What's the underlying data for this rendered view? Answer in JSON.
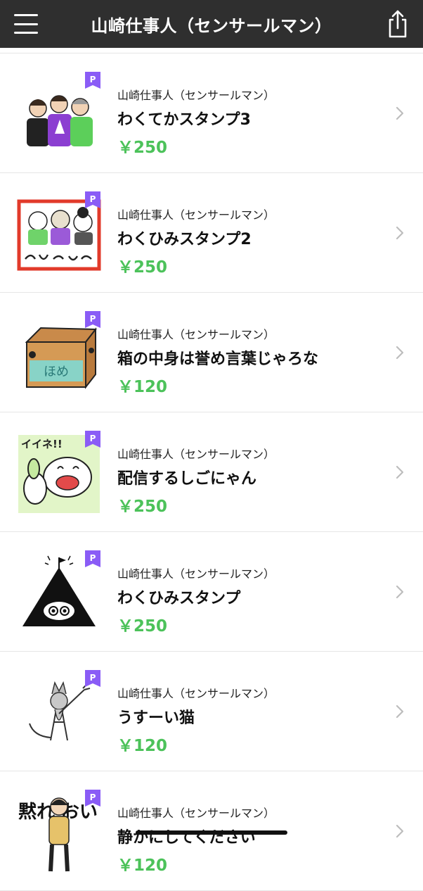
{
  "header": {
    "title": "山崎仕事人（センサールマン）",
    "menu_icon": "hamburger-menu-icon",
    "share_icon": "share-icon"
  },
  "colors": {
    "header_bg": "#2f2f2f",
    "price": "#4cc25a",
    "premium_badge": "#8a5cf6"
  },
  "products": [
    {
      "author": "山崎仕事人（センサールマン）",
      "name": "わくてかスタンプ3",
      "price": "￥250",
      "badge": "P",
      "thumb_icon": "three-men-sticker-icon"
    },
    {
      "author": "山崎仕事人（センサールマン）",
      "name": "わくひみスタンプ2",
      "price": "￥250",
      "badge": "P",
      "thumb_icon": "framed-three-faces-sticker-icon"
    },
    {
      "author": "山崎仕事人（センサールマン）",
      "name": "箱の中身は誉め言葉じゃろな",
      "price": "￥120",
      "badge": "P",
      "thumb_icon": "cardboard-box-sticker-icon",
      "thumb_text": "ほめ"
    },
    {
      "author": "山崎仕事人（センサールマン）",
      "name": "配信するしごにゃん",
      "price": "￥250",
      "badge": "P",
      "thumb_icon": "thumbs-up-cat-sticker-icon",
      "thumb_text": "イイネ!!"
    },
    {
      "author": "山崎仕事人（センサールマン）",
      "name": "わくひみスタンプ",
      "price": "￥250",
      "badge": "P",
      "thumb_icon": "triangle-eyes-sticker-icon"
    },
    {
      "author": "山崎仕事人（センサールマン）",
      "name": "うすーい猫",
      "price": "￥120",
      "badge": "P",
      "thumb_icon": "thin-cat-sticker-icon"
    },
    {
      "author": "山崎仕事人（センサールマン）",
      "name": "静かにしてください",
      "price": "￥120",
      "badge": "P",
      "thumb_icon": "quiet-man-sticker-icon",
      "thumb_text": "黙れ おい"
    }
  ]
}
